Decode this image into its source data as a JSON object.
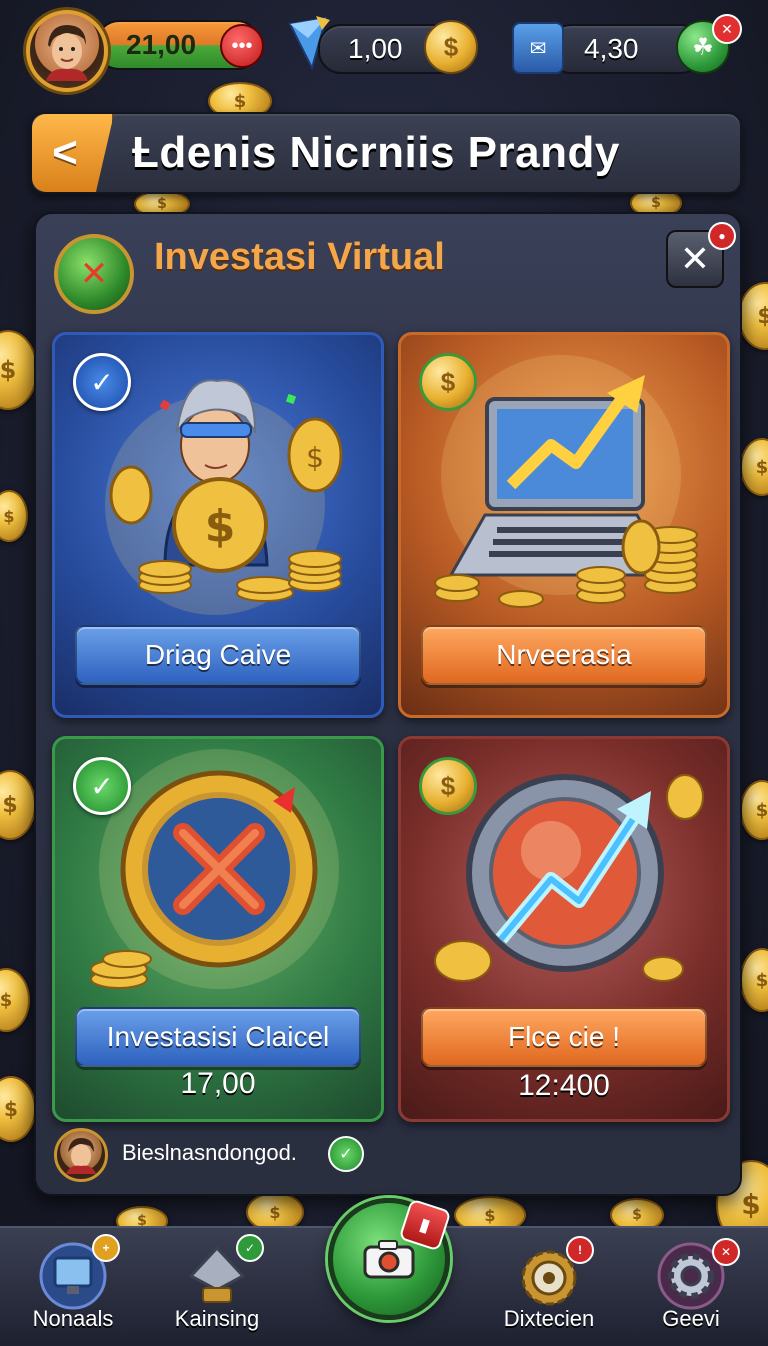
{
  "top_bar": {
    "balance": "21,00",
    "gems": "1,00",
    "tickets": "4,30",
    "icons": [
      "player-avatar",
      "more-dots-icon",
      "gem-arrow-icon",
      "gold-coin-icon",
      "ticket-icon",
      "clover-icon",
      "close-icon"
    ]
  },
  "header": {
    "back_symbol": "<",
    "title": "Ƚdenis Nicrniis Prandy"
  },
  "panel": {
    "title": "Investasi Virtual",
    "close_symbol": "✕",
    "cards": [
      {
        "button": "Driag Caive",
        "value": "",
        "theme": "blue",
        "badge": "check"
      },
      {
        "button": "Nrveerasia",
        "value": "",
        "theme": "orange",
        "badge": "coin"
      },
      {
        "button": "Investasisi Claicel",
        "value": "17,00",
        "theme": "green",
        "badge": "check"
      },
      {
        "button": "Flce cie !",
        "value": "12:400",
        "theme": "red",
        "badge": "coin"
      }
    ],
    "footer_text": "Bieslnasndongod."
  },
  "bottom_nav": {
    "items": [
      {
        "label": "Nonaals",
        "icon": "monitor-icon"
      },
      {
        "label": "Kainsing",
        "icon": "anvil-icon"
      },
      {
        "label": "",
        "icon": "camera-icon"
      },
      {
        "label": "Dixtecien",
        "icon": "gear-bomb-icon"
      },
      {
        "label": "Geevi",
        "icon": "settings-gear-icon"
      }
    ]
  },
  "colors": {
    "accent_orange": "#f3a64a",
    "background": "#1b1e2e",
    "panel": "#2c3144",
    "green": "#2e9a3a",
    "red": "#d02828"
  }
}
